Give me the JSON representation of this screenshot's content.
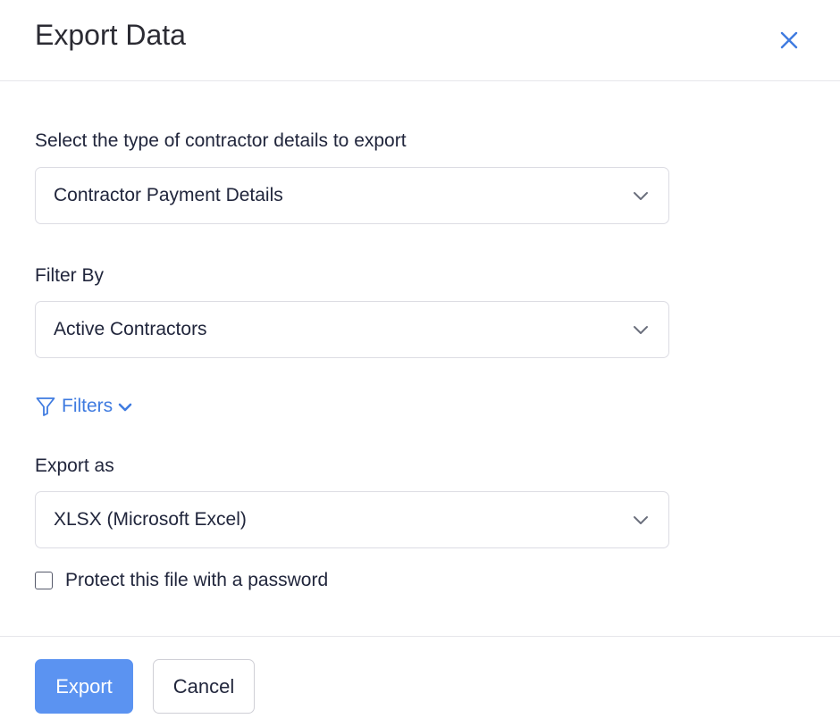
{
  "dialog": {
    "title": "Export Data"
  },
  "form": {
    "type_field": {
      "label": "Select the type of contractor details to export",
      "value": "Contractor Payment Details"
    },
    "filter_field": {
      "label": "Filter By",
      "value": "Active Contractors"
    },
    "filters_link": {
      "label": "Filters"
    },
    "format_field": {
      "label": "Export as",
      "value": "XLSX (Microsoft Excel)"
    },
    "password_checkbox": {
      "label": "Protect this file with a password",
      "checked": false
    }
  },
  "footer": {
    "export_label": "Export",
    "cancel_label": "Cancel"
  },
  "icons": {
    "close": "close-icon",
    "chevron": "chevron-down-icon",
    "funnel": "filter-icon"
  },
  "colors": {
    "accent": "#3f7be0",
    "primary_button": "#5b93f1",
    "border": "#dcdce3",
    "text": "#21263c"
  }
}
